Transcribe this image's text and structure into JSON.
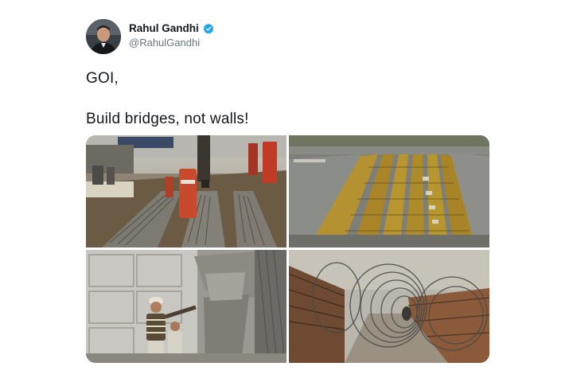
{
  "author": {
    "display_name": "Rahul Gandhi",
    "handle": "@RahulGandhi",
    "verified": true,
    "avatar_icon": "profile-photo",
    "verified_icon": "verified-badge-icon"
  },
  "tweet": {
    "lines": [
      "GOI,",
      "Build bridges, not walls!"
    ]
  },
  "media": {
    "count": 4,
    "items": [
      {
        "subject": "road-with-nails-photo"
      },
      {
        "subject": "aerial-barricades-photo"
      },
      {
        "subject": "cement-wall-construction-photo"
      },
      {
        "subject": "barbed-wire-barricade-photo"
      }
    ]
  },
  "colors": {
    "text": "#14171a",
    "handle": "#657786",
    "verified": "#1da1f2"
  }
}
